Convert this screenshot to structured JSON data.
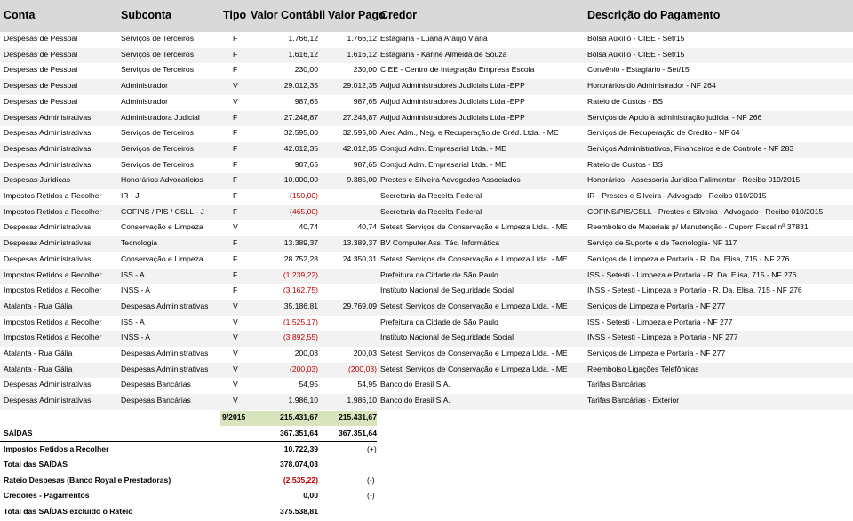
{
  "headers": {
    "conta": "Conta",
    "subconta": "Subconta",
    "tipo": "Tipo",
    "valor_contabil": "Valor Contábil",
    "valor_pago": "Valor Pago",
    "credor": "Credor",
    "descricao": "Descrição do Pagamento"
  },
  "rows": [
    {
      "conta": "Despesas de Pessoal",
      "subconta": "Serviços de Terceiros",
      "tipo": "F",
      "contabil": "1.766,12",
      "pago": "1.766,12",
      "credor": "Estagiária - Luana Araújo Viana",
      "descricao": "Bolsa Auxílio - CIEE - Set/15"
    },
    {
      "conta": "Despesas de Pessoal",
      "subconta": "Serviços de Terceiros",
      "tipo": "F",
      "contabil": "1.616,12",
      "pago": "1.616,12",
      "credor": "Estagiária - Karine Almeida de Souza",
      "descricao": "Bolsa Auxílio - CIEE - Set/15"
    },
    {
      "conta": "Despesas de Pessoal",
      "subconta": "Serviços de Terceiros",
      "tipo": "F",
      "contabil": "230,00",
      "pago": "230,00",
      "credor": "CIEE - Centro de Integração Empresa Escola",
      "descricao": "Convênio - Estagiário - Set/15"
    },
    {
      "conta": "Despesas de Pessoal",
      "subconta": "Administrador",
      "tipo": "V",
      "contabil": "29.012,35",
      "pago": "29.012,35",
      "credor": "Adjud Administradores Judiciais Ltda.-EPP",
      "descricao": "Honorários do Administrador - NF 264"
    },
    {
      "conta": "Despesas de Pessoal",
      "subconta": "Administrador",
      "tipo": "V",
      "contabil": "987,65",
      "pago": "987,65",
      "credor": "Adjud Administradores Judiciais Ltda.-EPP",
      "descricao": "Rateio de Custos - BS"
    },
    {
      "conta": "Despesas Administrativas",
      "subconta": "Administradora Judicial",
      "tipo": "F",
      "contabil": "27.248,87",
      "pago": "27.248,87",
      "credor": "Adjud Administradores Judiciais Ltda.-EPP",
      "descricao": "Serviços de Apoio à administração judicial - NF 266"
    },
    {
      "conta": "Despesas Administrativas",
      "subconta": "Serviços de Terceiros",
      "tipo": "F",
      "contabil": "32.595,00",
      "pago": "32.595,00",
      "credor": "Arec Adm., Neg. e Recuperação de Créd. Ltda. - ME",
      "descricao": "Serviços de Recuperação de Crédito - NF 64"
    },
    {
      "conta": "Despesas Administrativas",
      "subconta": "Serviços de Terceiros",
      "tipo": "F",
      "contabil": "42.012,35",
      "pago": "42.012,35",
      "credor": "Contjud Adm. Empresarial Ltda. - ME",
      "descricao": "Serviços Administrativos, Financeiros e de Controle - NF 283"
    },
    {
      "conta": "Despesas Administrativas",
      "subconta": "Serviços de Terceiros",
      "tipo": "F",
      "contabil": "987,65",
      "pago": "987,65",
      "credor": "Contjud Adm. Empresarial Ltda. - ME",
      "descricao": "Rateio de Custos - BS"
    },
    {
      "conta": "Despesas Jurídicas",
      "subconta": "Honorários Advocatícios",
      "tipo": "F",
      "contabil": "10.000,00",
      "pago": "9.385,00",
      "credor": "Prestes e Silveira Advogados Associados",
      "descricao": "Honorários - Assessoria Jurídica Falimentar - Recibo 010/2015"
    },
    {
      "conta": "Impostos Retidos a Recolher",
      "subconta": "IR - J",
      "tipo": "F",
      "contabil": "(150,00)",
      "pago": "",
      "credor": "Secretaria da Receita Federal",
      "descricao": "IR - Prestes e Silveira - Advogado - Recibo 010/2015",
      "neg": true
    },
    {
      "conta": "Impostos Retidos a Recolher",
      "subconta": "COFINS / PIS / CSLL - J",
      "tipo": "F",
      "contabil": "(465,00)",
      "pago": "",
      "credor": "Secretaria da Receita Federal",
      "descricao": "COFINS/PIS/CSLL - Prestes e Silveira - Advogado - Recibo 010/2015",
      "neg": true
    },
    {
      "conta": "Despesas Administrativas",
      "subconta": "Conservação e Limpeza",
      "tipo": "V",
      "contabil": "40,74",
      "pago": "40,74",
      "credor": "Setesti Serviços de Conservação e Limpeza Ltda. - ME",
      "descricao": "Reembolso de Materiais p/ Manutenção - Cupom Fiscal nº 37831"
    },
    {
      "conta": "Despesas Administrativas",
      "subconta": "Tecnologia",
      "tipo": "F",
      "contabil": "13.389,37",
      "pago": "13.389,37",
      "credor": "BV Computer Ass. Téc. Informática",
      "descricao": "Serviço de Suporte e de Tecnologia- NF 117"
    },
    {
      "conta": "Despesas Administrativas",
      "subconta": "Conservação e Limpeza",
      "tipo": "F",
      "contabil": "28.752,28",
      "pago": "24.350,31",
      "credor": "Setesti Serviços de Conservação e Limpeza Ltda. - ME",
      "descricao": "Serviços de Limpeza e Portaria - R. Da. Elisa, 715 - NF 276"
    },
    {
      "conta": "Impostos Retidos a Recolher",
      "subconta": "ISS - A",
      "tipo": "F",
      "contabil": "(1.239,22)",
      "pago": "",
      "credor": "Prefeitura da Cidade de São Paulo",
      "descricao": "ISS - Setesti - Limpeza e Portaria - R. Da. Elisa, 715 - NF 276",
      "neg": true
    },
    {
      "conta": "Impostos Retidos a Recolher",
      "subconta": "INSS - A",
      "tipo": "F",
      "contabil": "(3.162,75)",
      "pago": "",
      "credor": "Instituto Nacional de Seguridade Social",
      "descricao": "INSS - Setesti - Limpeza e Portaria - R. Da. Elisa, 715 - NF 276",
      "neg": true
    },
    {
      "conta": "Atalanta - Rua Gália",
      "subconta": "Despesas Administrativas",
      "tipo": "V",
      "contabil": "35.186,81",
      "pago": "29.769,09",
      "credor": "Setesti Serviços de Conservação e Limpeza Ltda. - ME",
      "descricao": "Serviços de Limpeza e Portaria - NF 277"
    },
    {
      "conta": "Impostos Retidos a Recolher",
      "subconta": "ISS - A",
      "tipo": "V",
      "contabil": "(1.525,17)",
      "pago": "",
      "credor": "Prefeitura da Cidade de São Paulo",
      "descricao": "ISS - Setesti - Limpeza e Portaria - NF 277",
      "neg": true
    },
    {
      "conta": "Impostos Retidos a Recolher",
      "subconta": "INSS - A",
      "tipo": "V",
      "contabil": "(3.892,55)",
      "pago": "",
      "credor": "Instituto Nacional de Seguridade Social",
      "descricao": "INSS - Setesti - Limpeza e Portaria - NF 277",
      "neg": true
    },
    {
      "conta": "Atalanta - Rua Gália",
      "subconta": "Despesas Administrativas",
      "tipo": "V",
      "contabil": "200,03",
      "pago": "200,03",
      "credor": "Setesti Serviços de Conservação e Limpeza Ltda. - ME",
      "descricao": "Serviços de Limpeza e Portaria - NF 277"
    },
    {
      "conta": "Atalanta - Rua Gália",
      "subconta": "Despesas Administrativas",
      "tipo": "V",
      "contabil": "(200,03)",
      "pago": "(200,03)",
      "credor": "Setesti Serviços de Conservação e Limpeza Ltda. - ME",
      "descricao": "Reembolso Ligações Telefônicas",
      "neg": true,
      "negpago": true
    },
    {
      "conta": "Despesas Administrativas",
      "subconta": "Despesas Bancárias",
      "tipo": "V",
      "contabil": "54,95",
      "pago": "54,95",
      "credor": "Banco do Brasil S.A.",
      "descricao": "Tarifas Bancárias"
    },
    {
      "conta": "Despesas Administrativas",
      "subconta": "Despesas Bancárias",
      "tipo": "V",
      "contabil": "1.986,10",
      "pago": "1.986,10",
      "credor": "Banco do Brasil S.A.",
      "descricao": "Tarifas Bancárias - Exterior"
    }
  ],
  "subtotal": {
    "label": "9/2015",
    "contabil": "215.431,67",
    "pago": "215.431,67"
  },
  "summary": [
    {
      "label": "SAÍDAS",
      "contabil": "367.351,64",
      "pago": "367.351,64",
      "sign": ""
    },
    {
      "label": "Impostos Retidos a Recolher",
      "contabil": "10.722,39",
      "pago": "",
      "sign": "(+)"
    },
    {
      "label": "Total das SAÍDAS",
      "contabil": "378.074,03",
      "pago": "",
      "sign": ""
    },
    {
      "label": "Rateio Despesas (Banco Royal e Prestadoras)",
      "contabil": "(2.535,22)",
      "pago": "",
      "sign": "(-)",
      "neg": true
    },
    {
      "label": "Credores - Pagamentos",
      "contabil": "0,00",
      "pago": "",
      "sign": "(-)"
    },
    {
      "label": "Total das SAÍDAS excluído o Rateio",
      "contabil": "375.538,81",
      "pago": "",
      "sign": ""
    }
  ],
  "colors": {
    "header_bg": "#d9d9d9",
    "negative": "#c00000",
    "subtotal_bg": "#d8e4bc"
  }
}
